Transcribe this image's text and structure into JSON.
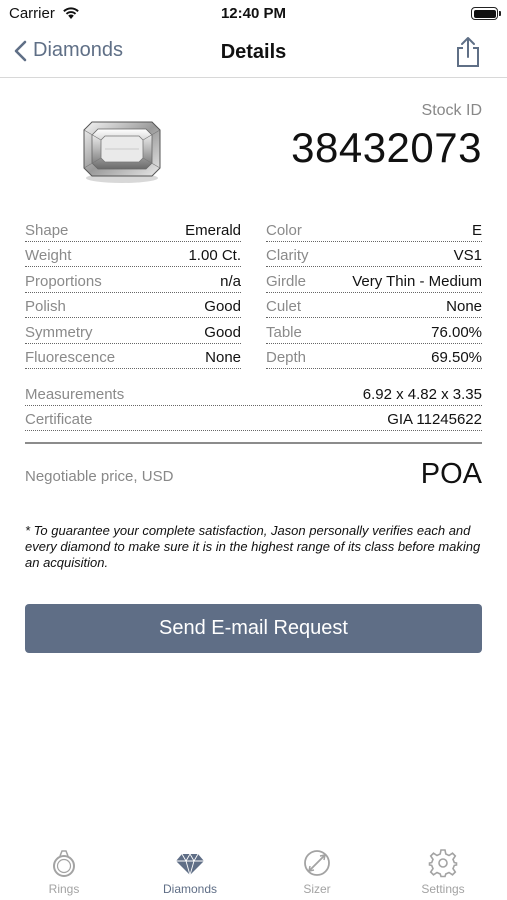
{
  "status_bar": {
    "carrier": "Carrier",
    "time": "12:40 PM"
  },
  "nav": {
    "back_label": "Diamonds",
    "title": "Details"
  },
  "stock": {
    "label": "Stock ID",
    "id": "38432073"
  },
  "specs_left": [
    {
      "label": "Shape",
      "value": "Emerald"
    },
    {
      "label": "Weight",
      "value": "1.00 Ct."
    },
    {
      "label": "Proportions",
      "value": "n/a"
    },
    {
      "label": "Polish",
      "value": "Good"
    },
    {
      "label": "Symmetry",
      "value": "Good"
    },
    {
      "label": "Fluorescence",
      "value": "None"
    }
  ],
  "specs_right": [
    {
      "label": "Color",
      "value": "E"
    },
    {
      "label": "Clarity",
      "value": "VS1"
    },
    {
      "label": "Girdle",
      "value": "Very Thin - Medium"
    },
    {
      "label": "Culet",
      "value": "None"
    },
    {
      "label": "Table",
      "value": "76.00%"
    },
    {
      "label": "Depth",
      "value": "69.50%"
    }
  ],
  "specs_wide": [
    {
      "label": "Measurements",
      "value": "6.92 x 4.82 x 3.35"
    },
    {
      "label": "Certificate",
      "value": "GIA 11245622"
    }
  ],
  "price": {
    "label": "Negotiable price, USD",
    "value": "POA"
  },
  "disclaimer": "* To guarantee your complete satisfaction, Jason personally verifies each and every diamond to make sure it is in the highest range of its class before making an acquisition.",
  "email_button": "Send E-mail Request",
  "tabs": [
    {
      "label": "Rings",
      "icon": "ring-icon"
    },
    {
      "label": "Diamonds",
      "icon": "diamond-icon"
    },
    {
      "label": "Sizer",
      "icon": "sizer-icon"
    },
    {
      "label": "Settings",
      "icon": "gear-icon"
    }
  ],
  "colors": {
    "accent": "#5f6e86",
    "inactive_tab": "#a3a3a3",
    "label_gray": "#8a8a8a"
  }
}
